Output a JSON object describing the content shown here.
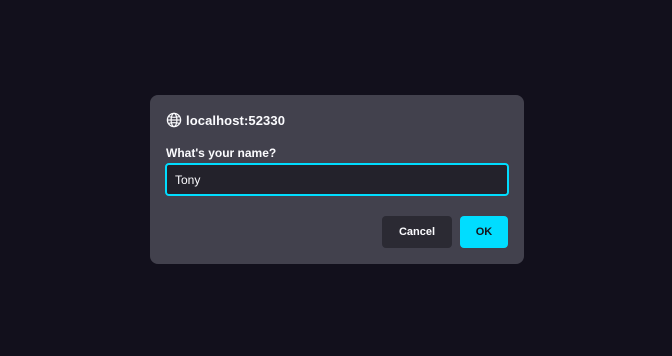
{
  "dialog": {
    "origin": "localhost:52330",
    "origin_icon": "globe-icon",
    "message": "What's your name?",
    "input_value": "Tony",
    "cancel_label": "Cancel",
    "ok_label": "OK"
  },
  "colors": {
    "backdrop": "#12101c",
    "dialog_bg": "#42414d",
    "accent": "#00ddff",
    "input_bg": "#23222b",
    "cancel_bg": "#2b2a33",
    "text": "#fbfbfe"
  }
}
